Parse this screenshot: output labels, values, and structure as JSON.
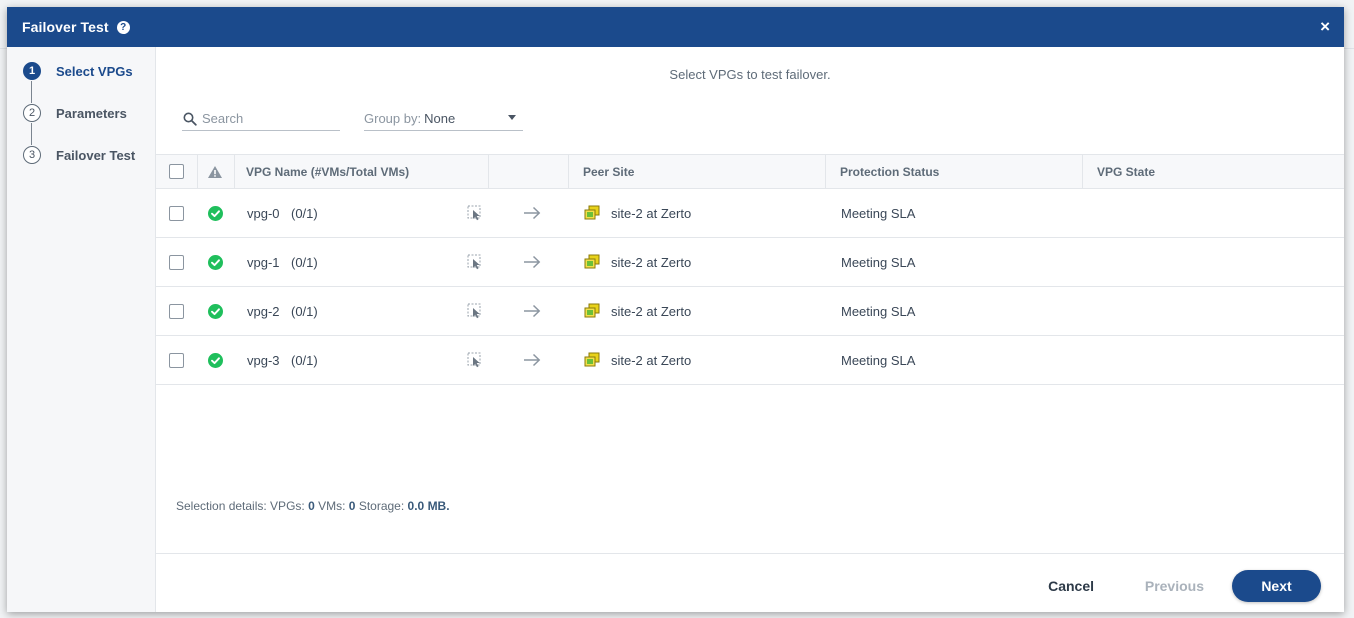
{
  "dialog": {
    "title": "Failover Test",
    "help_glyph": "?",
    "close_glyph": "×"
  },
  "steps": [
    {
      "num": "1",
      "label": "Select VPGs",
      "active": true
    },
    {
      "num": "2",
      "label": "Parameters",
      "active": false
    },
    {
      "num": "3",
      "label": "Failover Test",
      "active": false
    }
  ],
  "instruction": "Select VPGs to test failover.",
  "search": {
    "placeholder": "Search",
    "value": ""
  },
  "groupby": {
    "label": "Group by:",
    "value": "None"
  },
  "table": {
    "columns": {
      "name": "VPG Name (#VMs/Total VMs)",
      "peer": "Peer Site",
      "status": "Protection Status",
      "state": "VPG State"
    },
    "rows": [
      {
        "name": "vpg-0",
        "vms": "(0/1)",
        "peer": "site-2 at Zerto",
        "status": "Meeting SLA",
        "state": ""
      },
      {
        "name": "vpg-1",
        "vms": "(0/1)",
        "peer": "site-2 at Zerto",
        "status": "Meeting SLA",
        "state": ""
      },
      {
        "name": "vpg-2",
        "vms": "(0/1)",
        "peer": "site-2 at Zerto",
        "status": "Meeting SLA",
        "state": ""
      },
      {
        "name": "vpg-3",
        "vms": "(0/1)",
        "peer": "site-2 at Zerto",
        "status": "Meeting SLA",
        "state": ""
      }
    ]
  },
  "selection": {
    "prefix": "Selection details: VPGs:",
    "vpgs": "0",
    "vms_label": "VMs:",
    "vms": "0",
    "storage_label": "Storage:",
    "storage": "0.0 MB."
  },
  "footer": {
    "cancel": "Cancel",
    "previous": "Previous",
    "next": "Next"
  },
  "colors": {
    "brand": "#1b4a8c",
    "ok": "#1fbf5c",
    "site_icon": "#e8d21a"
  }
}
